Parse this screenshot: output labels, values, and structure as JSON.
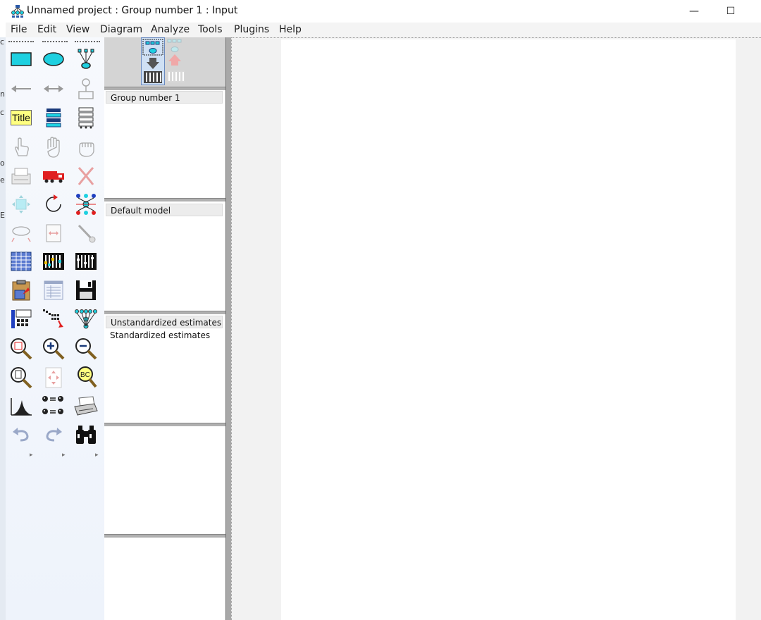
{
  "window": {
    "title": "Unnamed project : Group number 1 : Input",
    "minimize_glyph": "—",
    "maximize_glyph": "☐"
  },
  "menu": [
    "File",
    "Edit",
    "View",
    "Diagram",
    "Analyze",
    "Tools",
    "Plugins",
    "Help"
  ],
  "behind_window_chars": [
    "c",
    "n",
    "c",
    "o",
    "e",
    "E"
  ],
  "toolbox": {
    "title_tool_label": "Title",
    "tools": [
      "draw-observed-variable-icon",
      "draw-unobserved-variable-icon",
      "draw-latent-indicator-icon",
      "draw-path-icon",
      "draw-covariance-icon",
      "add-unique-variable-icon",
      "figure-caption-icon",
      "list-variables-in-model-icon",
      "list-variables-in-dataset-icon",
      "select-one-object-icon",
      "select-all-objects-icon",
      "deselect-all-objects-icon",
      "duplicate-objects-icon",
      "move-objects-icon",
      "erase-objects-icon",
      "change-shape-icon",
      "rotate-indicators-icon",
      "reflect-indicators-icon",
      "move-parameters-icon",
      "scroll-icon",
      "touch-up-icon",
      "select-data-files-icon",
      "analysis-properties-icon",
      "calculate-estimates-icon",
      "copy-to-clipboard-icon",
      "view-text-icon",
      "save-diagram-icon",
      "object-properties-icon",
      "drag-properties-icon",
      "preserve-symmetries-icon",
      "zoom-in-area-icon",
      "zoom-in-icon",
      "zoom-out-icon",
      "view-page-icon",
      "fit-to-page-icon",
      "loupe-icon",
      "bayesian-estimation-icon",
      "multiple-group-analysis-icon",
      "print-icon",
      "undo-icon",
      "redo-icon",
      "specification-search-icon"
    ],
    "more_arrows": [
      "▸",
      "▸",
      "▸"
    ]
  },
  "panels": {
    "groups": [
      "Group number 1"
    ],
    "models": [
      "Default model"
    ],
    "estimates": [
      "Unstandardized estimates",
      "Standardized estimates"
    ]
  },
  "colors": {
    "accent_cyan": "#1ed0e0",
    "title_yellow": "#ffff80",
    "red": "#e02020",
    "navy": "#1a3a7a"
  }
}
